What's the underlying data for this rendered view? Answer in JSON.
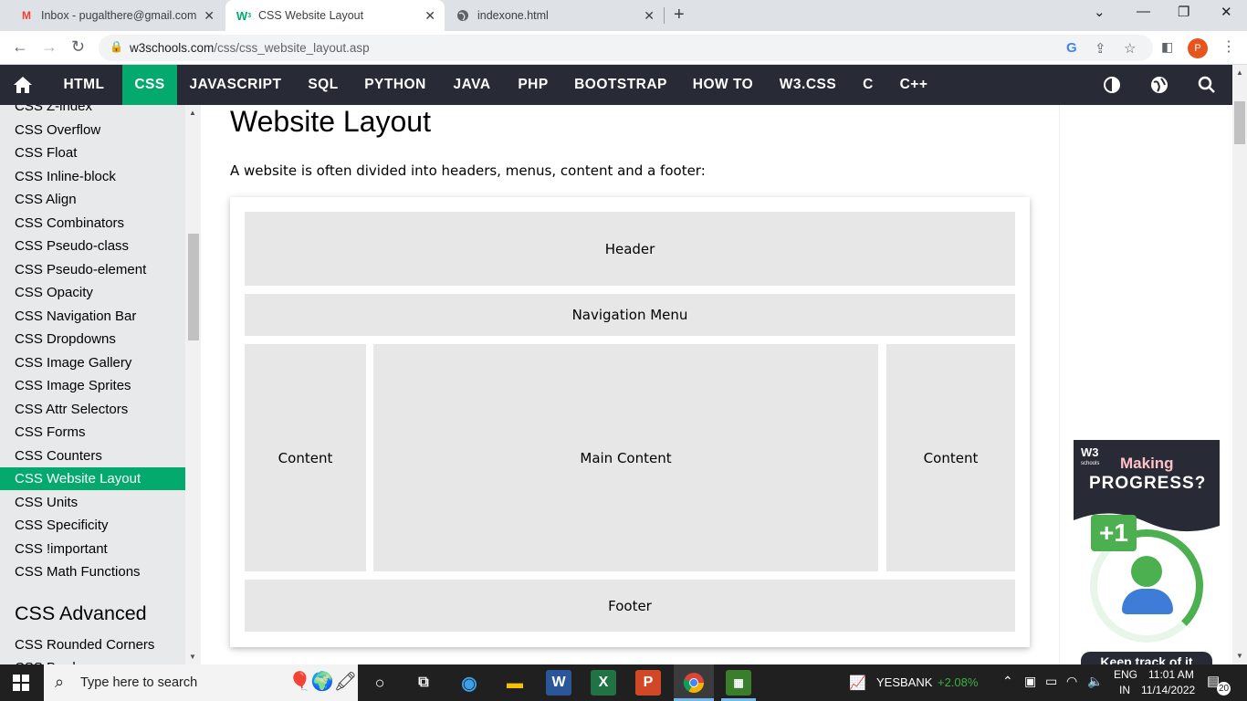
{
  "browser": {
    "tabs": [
      {
        "title": "Inbox - pugalthere@gmail.com -",
        "icon": "gmail-icon"
      },
      {
        "title": "CSS Website Layout",
        "icon": "w3schools-icon"
      },
      {
        "title": "indexone.html",
        "icon": "globe-icon"
      }
    ],
    "url_host": "w3schools.com",
    "url_path": "/css/css_website_layout.asp"
  },
  "topnav": {
    "items": [
      "HTML",
      "CSS",
      "JAVASCRIPT",
      "SQL",
      "PYTHON",
      "JAVA",
      "PHP",
      "BOOTSTRAP",
      "HOW TO",
      "W3.CSS",
      "C",
      "C++"
    ],
    "active": "CSS"
  },
  "sidebar": {
    "links": [
      "CSS Z-index",
      "CSS Overflow",
      "CSS Float",
      "CSS Inline-block",
      "CSS Align",
      "CSS Combinators",
      "CSS Pseudo-class",
      "CSS Pseudo-element",
      "CSS Opacity",
      "CSS Navigation Bar",
      "CSS Dropdowns",
      "CSS Image Gallery",
      "CSS Image Sprites",
      "CSS Attr Selectors",
      "CSS Forms",
      "CSS Counters",
      "CSS Website Layout",
      "CSS Units",
      "CSS Specificity",
      "CSS !important",
      "CSS Math Functions"
    ],
    "active": "CSS Website Layout",
    "section_heading": "CSS Advanced",
    "after_links": [
      "CSS Rounded Corners",
      "CSS Borders"
    ]
  },
  "main": {
    "title": "Website Layout",
    "intro": "A website is often divided into headers, menus, content and a footer:",
    "demo": {
      "header": "Header",
      "nav": "Navigation Menu",
      "left": "Content",
      "center": "Main Content",
      "right": "Content",
      "footer": "Footer"
    }
  },
  "ad": {
    "logo": "W3",
    "logo_sub": "schools",
    "line1": "Making",
    "line2": "PROGRESS?",
    "badge": "+1",
    "cta": "Keep track of it"
  },
  "taskbar": {
    "search_placeholder": "Type here to search",
    "stock_name": "YESBANK",
    "stock_change": "+2.08%",
    "lang": "ENG",
    "region": "IN",
    "time": "11:01 AM",
    "date": "11/14/2022",
    "notifications": "20"
  },
  "colors": {
    "w3_green": "#04aa6d",
    "nav_dark": "#282a35",
    "sidebar_bg": "#e7e9eb",
    "demo_block": "#e7e7e7"
  }
}
